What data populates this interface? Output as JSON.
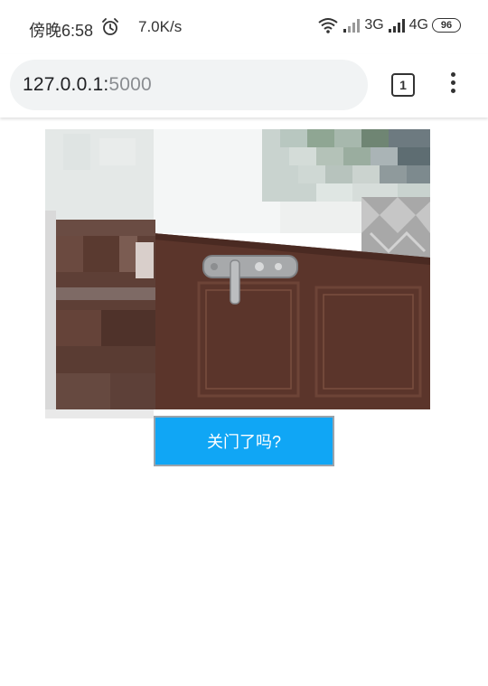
{
  "status_bar": {
    "time": "傍晚6:58",
    "net_speed": "7.0K/s",
    "network_1": "3G",
    "network_2": "4G",
    "battery": "96"
  },
  "browser": {
    "url_host": "127.0.0.1:",
    "url_port": "5000",
    "tab_count": "1"
  },
  "content": {
    "button_label": "关门了吗?"
  }
}
